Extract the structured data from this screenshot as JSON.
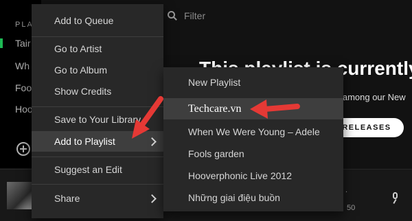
{
  "sidebar": {
    "header": "PLA",
    "items": [
      "Tair",
      "Wh",
      "Foo",
      "Hoo"
    ]
  },
  "search": {
    "placeholder": "Filter"
  },
  "hero": {
    "title": "This playlist is currently",
    "subtitle": "e among our New",
    "button": "RELEASES"
  },
  "player": {
    "time_fragment": "50",
    "dot": "."
  },
  "context_menu": {
    "items": [
      "Add to Queue",
      "Go to Artist",
      "Go to Album",
      "Show Credits",
      "Save to Your Library",
      "Add to Playlist",
      "Suggest an Edit",
      "Share"
    ]
  },
  "playlist_submenu": {
    "items": [
      "New Playlist",
      "Techcare.vn",
      "When We Were Young – Adele",
      "Fools garden",
      "Hooverphonic Live 2012",
      "Những giai điệu buồn"
    ]
  },
  "colors": {
    "accent": "#1db954",
    "annotation_arrow": "#e53935",
    "menu_bg": "#282828",
    "highlight": "#3e3e3e"
  }
}
